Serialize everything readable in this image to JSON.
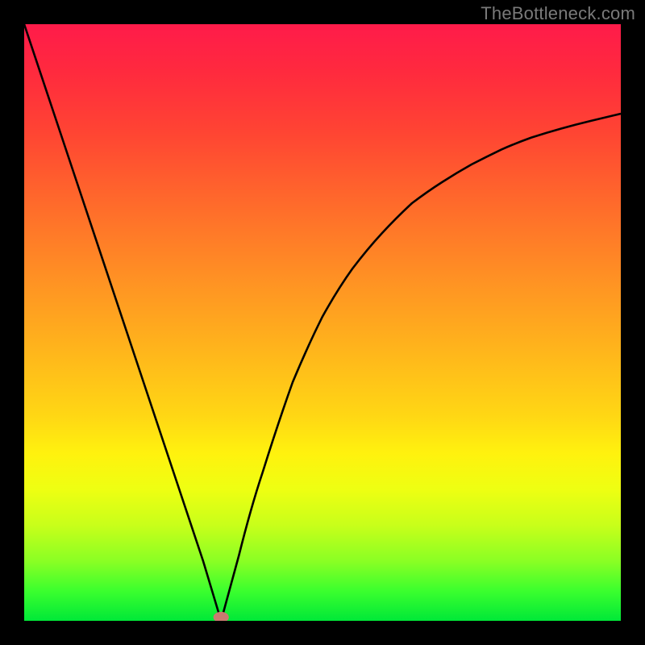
{
  "watermark": "TheBottleneck.com",
  "colors": {
    "frame": "#000000",
    "curve": "#000000",
    "marker": "#c97a70",
    "gradient_top": "#ff1b4a",
    "gradient_mid": "#ffd814",
    "gradient_bottom": "#00e838"
  },
  "chart_data": {
    "type": "line",
    "title": "",
    "xlabel": "",
    "ylabel": "",
    "xlim": [
      0,
      100
    ],
    "ylim": [
      0,
      100
    ],
    "grid": false,
    "legend": false,
    "note": "Axes have no tick labels in the source image; all values below are estimated from pixel positions relative to the plot-area and expressed as 0–100 percentages of each axis.",
    "series": [
      {
        "name": "left-branch",
        "x": [
          0,
          5,
          10,
          15,
          20,
          25,
          30,
          33
        ],
        "y": [
          100,
          85,
          70,
          55,
          40,
          25,
          10,
          0
        ]
      },
      {
        "name": "right-branch",
        "x": [
          33,
          36,
          40,
          45,
          50,
          55,
          60,
          65,
          70,
          75,
          80,
          85,
          90,
          95,
          100
        ],
        "y": [
          0,
          11,
          25,
          40,
          51,
          59,
          65,
          70,
          73.5,
          76.5,
          79,
          81,
          82.5,
          83.8,
          85
        ]
      }
    ],
    "marker": {
      "x": 33,
      "y": 0,
      "shape": "ellipse",
      "color": "#c97a70"
    }
  }
}
